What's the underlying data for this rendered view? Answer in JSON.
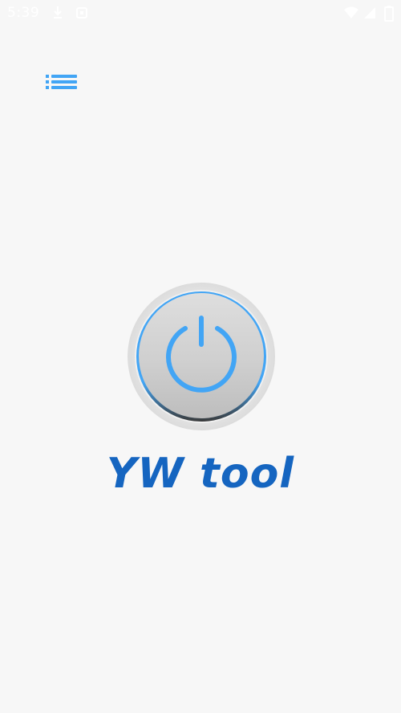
{
  "status_bar": {
    "time": "5:39",
    "icons": [
      "download-icon",
      "app-notification-icon",
      "wifi-icon",
      "cellular-signal-icon",
      "battery-icon"
    ]
  },
  "toolbar": {
    "menu_icon": "list-menu-icon"
  },
  "power_button": {
    "icon": "power-icon",
    "accent_color": "#42a5f5"
  },
  "app": {
    "title": "YW tool",
    "title_color": "#1565c0"
  }
}
